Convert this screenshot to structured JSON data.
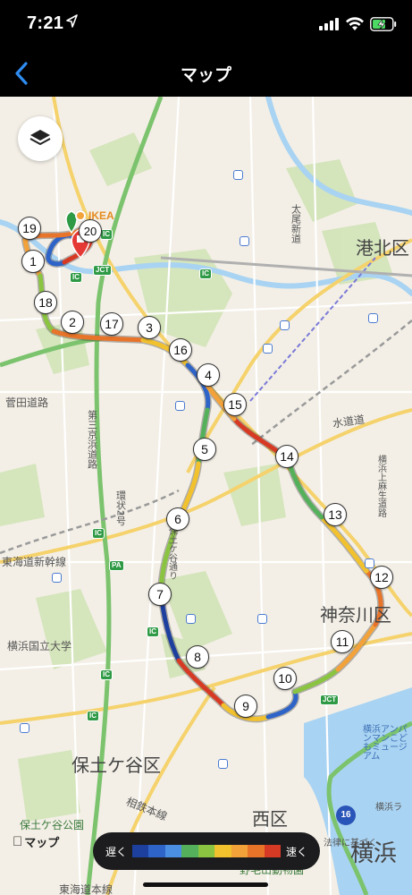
{
  "status_bar": {
    "time": "7:21",
    "location_icon": "location-arrow-icon",
    "signal_icon": "signal-bars-icon",
    "wifi_icon": "wifi-icon",
    "battery_icon": "battery-charging-icon"
  },
  "nav": {
    "title": "マップ",
    "back_icon": "chevron-left-icon"
  },
  "map": {
    "layers_icon": "layers-icon",
    "poi": {
      "ikea": "IKEA"
    },
    "districts": {
      "kohoku": "港北区",
      "kanagawa": "神奈川区",
      "hodogaya": "保土ケ谷区",
      "nishi": "西区",
      "yokohama": "横浜"
    },
    "labels": {
      "tokaido_shinkansen": "東海道新幹線",
      "yokohama_national_univ": "横浜国立大学",
      "hodogaya_park": "保土ケ谷公園",
      "nogeyama_zoo": "野毛山動物園",
      "hodogaya_line": "相鉄本線",
      "tokaido_honsen": "東海道本線",
      "suido_road": "水道道",
      "kogaya_road": "菅田道路",
      "daisan_keihin": "第三京浜道路",
      "daio_shinmichi": "太尾新道",
      "kanjo2": "環状2号",
      "hodogaya_street": "保土ケ谷通り",
      "route_road": "横浜上麻生道路",
      "yokohama_anpanman": "横浜アンパンマンこどもミュージアム",
      "hourstreet_park": "法律に基づく",
      "route16": "16",
      "yokohama_ra": "横浜ラ"
    },
    "badges": {
      "ic": "IC",
      "jct": "JCT",
      "pa": "PA"
    },
    "km_markers": [
      "1",
      "2",
      "3",
      "4",
      "5",
      "6",
      "7",
      "8",
      "9",
      "10",
      "11",
      "12",
      "13",
      "14",
      "15",
      "16",
      "17",
      "18",
      "19",
      "20"
    ],
    "attribution": "マップ",
    "apple_glyph": ""
  },
  "legend": {
    "slow_label": "遅く",
    "fast_label": "速く",
    "colors": [
      "#1d3f9e",
      "#2e63c7",
      "#4b8fe3",
      "#54b05a",
      "#8ac441",
      "#f2c12e",
      "#f3a23a",
      "#e8742a",
      "#d63a24"
    ]
  }
}
